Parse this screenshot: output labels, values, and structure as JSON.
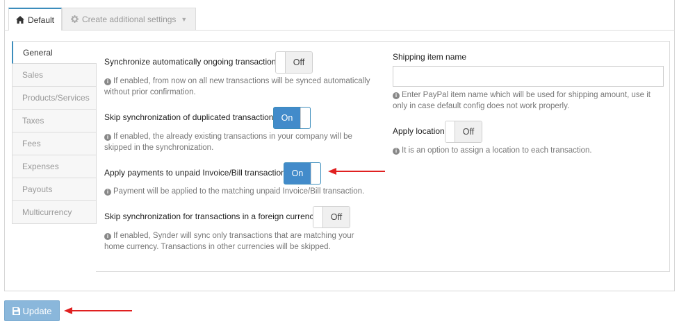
{
  "tabs": {
    "default_label": "Default",
    "additional_label": "Create additional settings"
  },
  "sidebar": {
    "items": [
      {
        "label": "General"
      },
      {
        "label": "Sales"
      },
      {
        "label": "Products/Services"
      },
      {
        "label": "Taxes"
      },
      {
        "label": "Fees"
      },
      {
        "label": "Expenses"
      },
      {
        "label": "Payouts"
      },
      {
        "label": "Multicurrency"
      }
    ]
  },
  "settings": {
    "sync_auto": {
      "label": "Synchronize automatically ongoing transactions",
      "state": "Off",
      "help": "If enabled, from now on all new transactions will be synced automatically without prior confirmation."
    },
    "skip_duplicates": {
      "label": "Skip synchronization of duplicated transactions",
      "state": "On",
      "help": "If enabled, the already existing transactions in your company will be skipped in the synchronization."
    },
    "apply_payments": {
      "label": "Apply payments to unpaid Invoice/Bill transactions",
      "state": "On",
      "help": "Payment will be applied to the matching unpaid Invoice/Bill transaction."
    },
    "skip_foreign": {
      "label": "Skip synchronization for transactions in a foreign currency.",
      "state": "Off",
      "help": "If enabled, Synder will sync only transactions that are matching your home currency. Transactions in other currencies will be skipped."
    },
    "shipping_item": {
      "label": "Shipping item name",
      "value": "",
      "placeholder": "",
      "help": "Enter PayPal item name which will be used for shipping amount, use it only in case default config does not work properly."
    },
    "apply_location": {
      "label": "Apply location",
      "state": "Off",
      "help": "It is an option to assign a location to each transaction."
    }
  },
  "footer": {
    "update_label": "Update"
  },
  "colors": {
    "accent": "#428bca",
    "update_button": "#8ab7db",
    "arrow": "#e02020"
  }
}
